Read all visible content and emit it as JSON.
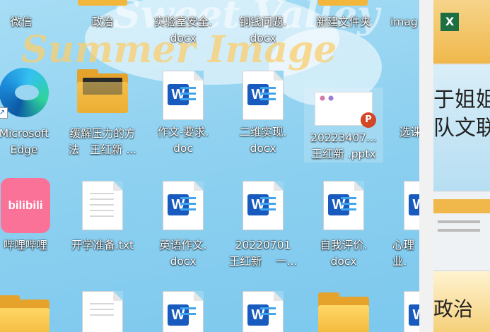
{
  "wallpaper": {
    "words": [
      "Sweet Valley",
      "Summer Image"
    ]
  },
  "desktop": {
    "rows": [
      [
        {
          "label": "微信"
        },
        {
          "label": "政治"
        },
        {
          "label": "实验室安全.\ndocx"
        },
        {
          "label": "铜钱问题.\ndocx"
        },
        {
          "label": "新建文件夹"
        },
        {
          "label": "imag"
        }
      ],
      [
        {
          "label": "Microsoft\nEdge",
          "icon": "edge-icon"
        },
        {
          "label": "缓解压力的方\n法   王红新 ...",
          "icon": "folder-icon"
        },
        {
          "label": "作文-要求.\ndoc",
          "icon": "word-icon"
        },
        {
          "label": "二维实现.\ndocx",
          "icon": "word-icon"
        },
        {
          "label": "20223407...\n王红新 .pptx",
          "icon": "powerpoint-icon"
        },
        {
          "label": "选课",
          "icon": "folder-icon"
        }
      ],
      [
        {
          "label": "哔哩哔哩",
          "icon": "bilibili-icon"
        },
        {
          "label": "开学准备.txt",
          "icon": "text-file-icon"
        },
        {
          "label": "英语作文.\ndocx",
          "icon": "word-icon"
        },
        {
          "label": "20220701\n王红新    一...",
          "icon": "word-icon"
        },
        {
          "label": "自我评价.\ndocx",
          "icon": "word-icon"
        },
        {
          "label": "心理\n业.",
          "icon": "word-icon"
        }
      ],
      [
        {
          "label": "",
          "icon": "folder-icon"
        },
        {
          "label": "",
          "icon": "text-file-icon"
        },
        {
          "label": "",
          "icon": "word-icon"
        },
        {
          "label": "",
          "icon": "word-icon"
        },
        {
          "label": "",
          "icon": "folder-icon"
        },
        {
          "label": "",
          "icon": "word-icon"
        }
      ]
    ],
    "badges": {
      "word": "W",
      "powerpoint": "P",
      "bilibili": "bilibili"
    }
  },
  "side_panel": {
    "snippets": [
      "于姐姐",
      "队文联",
      "政治"
    ]
  }
}
